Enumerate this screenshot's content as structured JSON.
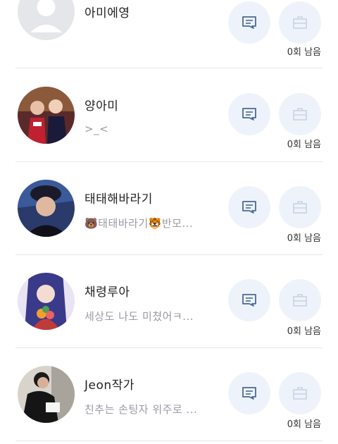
{
  "friends": [
    {
      "name": "아미에영",
      "status": "",
      "remaining": "0회 남음",
      "avatar": "default-avatar"
    },
    {
      "name": "양아미",
      "status": ">_<",
      "remaining": "0회 남음",
      "avatar": "photo-avatar"
    },
    {
      "name": "태태해바라기",
      "status": "🐻태태바라기🐯반모...",
      "remaining": "0회 남음",
      "avatar": "photo-avatar"
    },
    {
      "name": "채령루아",
      "status": "세상도 나도 미쳤어ㅋ...",
      "remaining": "0회 남음",
      "avatar": "illustration-avatar"
    },
    {
      "name": "Jeon작가",
      "status": "친추는 손팅자 위주로 ...",
      "remaining": "0회 남음",
      "avatar": "photo-avatar"
    }
  ],
  "icons": {
    "message": "message-icon",
    "gift": "gift-box-icon"
  },
  "colors": {
    "accent": "#4a6a96",
    "button_bg": "#eef3fb",
    "button_disabled": "#c8d3e2",
    "divider": "#e6e6ea"
  }
}
